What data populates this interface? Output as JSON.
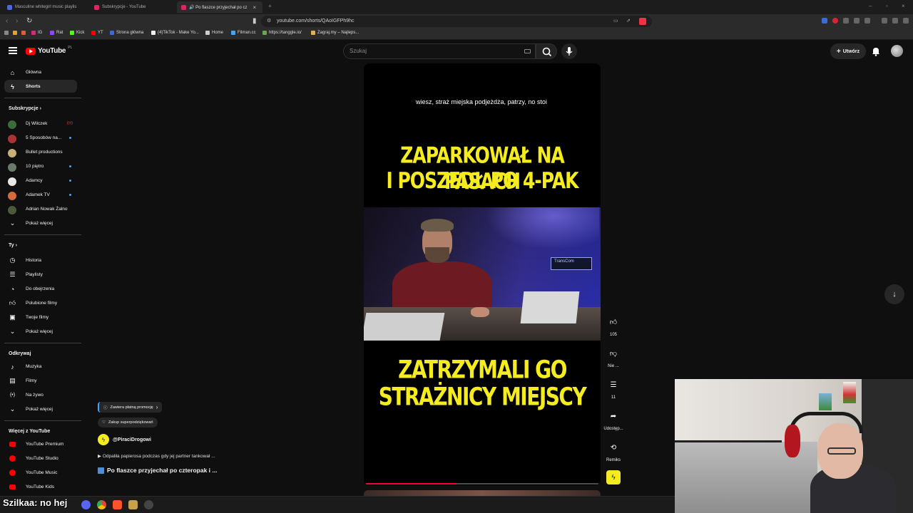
{
  "browser": {
    "tabs": [
      {
        "label": "Masculine whitegirl music playlis"
      },
      {
        "label": "Subskrypcje - YouTube"
      },
      {
        "label": "🔊 Po flaszce przyjechał po cz"
      }
    ],
    "url": "youtube.com/shorts/QAoIGFPh9hc",
    "bookmarks": [
      "IG",
      "Rat",
      "Kick",
      "YT",
      "Strona główna",
      "(4)TikTok - Make Yo...",
      "Home",
      "Filman.cc",
      "https://tanggle.io/",
      "Zagraj.my – Najleps..."
    ]
  },
  "header": {
    "logo": "YouTube",
    "region": "PL",
    "search_placeholder": "Szukaj",
    "create_label": "Utwórz"
  },
  "sidebar": {
    "main": [
      {
        "label": "Główna",
        "icon": "home-icon"
      },
      {
        "label": "Shorts",
        "icon": "shorts-icon"
      }
    ],
    "subs_heading": "Subskrypcje",
    "subs": [
      {
        "label": "Dj Wilczek",
        "color": "#3a6b3a",
        "live": true
      },
      {
        "label": "5 Sposobów na...",
        "color": "#a33",
        "dot": true
      },
      {
        "label": "Bullet productions",
        "color": "#c9b27a"
      },
      {
        "label": "10 piętro",
        "color": "#6c7a6c",
        "dot": true
      },
      {
        "label": "Adamcy",
        "color": "#e8e8e8",
        "dot": true
      },
      {
        "label": "Adamek TV",
        "color": "#d66a3a",
        "dot": true
      },
      {
        "label": "Adrian Nowak Żalno",
        "color": "#4a5a3a"
      }
    ],
    "subs_more": "Pokaż więcej",
    "you_heading": "Ty",
    "you": [
      {
        "label": "Historia",
        "icon": "history-icon"
      },
      {
        "label": "Playlisty",
        "icon": "playlist-icon"
      },
      {
        "label": "Do obejrzenia",
        "icon": "watch-later-icon"
      },
      {
        "label": "Polubione filmy",
        "icon": "like-icon"
      },
      {
        "label": "Twoje filmy",
        "icon": "your-videos-icon"
      }
    ],
    "you_more": "Pokaż więcej",
    "explore_heading": "Odkrywaj",
    "explore": [
      {
        "label": "Muzyka",
        "icon": "music-icon"
      },
      {
        "label": "Filmy",
        "icon": "movies-icon"
      },
      {
        "label": "Na żywo",
        "icon": "live-icon"
      }
    ],
    "explore_more": "Pokaż więcej",
    "more_heading": "Więcej z YouTube",
    "more": [
      {
        "label": "YouTube Premium"
      },
      {
        "label": "YouTube Studio"
      },
      {
        "label": "YouTube Music"
      },
      {
        "label": "YouTube Kids"
      }
    ]
  },
  "short": {
    "subtitle": "wiesz, straż miejska podjeżdża, patrzy, no stoi",
    "caption_top_1": "ZAPARKOWAŁ NA PASACH",
    "caption_top_2": "I POSZEDŁ PO 4-PAK",
    "caption_bottom_1": "ZATRZYMALI GO",
    "caption_bottom_2": "STRAŻNICY MIEJSCY",
    "scene_sign": "TransCom",
    "progress": 0.39,
    "promo_label": "Zawiera płatną promocję",
    "thanks_label": "Zakup superpodziękowań",
    "channel": "@PiraciDrogowi",
    "related": "Odpaliła papierosa podczas gdy jej partner tankował ...",
    "title": "Po flaszce przyjechał po czteropak i ..."
  },
  "actions": {
    "likes": "105",
    "dislike_label": "Nie ...",
    "comments": "11",
    "share_label": "Udostęp...",
    "remix_label": "Remiks"
  },
  "overlay": {
    "chat_text": "Szilkaa: no hej"
  }
}
